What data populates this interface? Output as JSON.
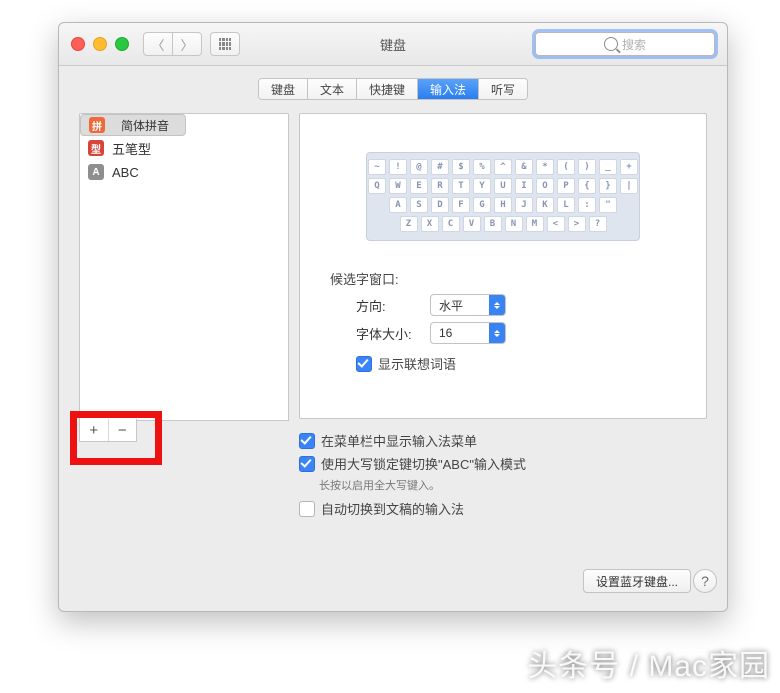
{
  "window": {
    "title": "键盘"
  },
  "search": {
    "placeholder": "搜索"
  },
  "tabs": [
    "键盘",
    "文本",
    "快捷键",
    "输入法",
    "听写"
  ],
  "active_tab_index": 3,
  "sources": [
    {
      "badge": "拼",
      "badge_color": "b-orange",
      "label": "简体拼音",
      "selected": true
    },
    {
      "badge": "型",
      "badge_color": "b-red",
      "label": "五笔型",
      "selected": false
    },
    {
      "badge": "A",
      "badge_color": "b-gray",
      "label": "ABC",
      "selected": false
    }
  ],
  "keyboard": {
    "r1": [
      "~",
      "!",
      "@",
      "#",
      "$",
      "%",
      "^",
      "&",
      "*",
      "(",
      ")",
      "_",
      "+"
    ],
    "r2": [
      "Q",
      "W",
      "E",
      "R",
      "T",
      "Y",
      "U",
      "I",
      "O",
      "P",
      "{",
      "}",
      "|"
    ],
    "r3": [
      "A",
      "S",
      "D",
      "F",
      "G",
      "H",
      "J",
      "K",
      "L",
      ":",
      "\""
    ],
    "r4": [
      "Z",
      "X",
      "C",
      "V",
      "B",
      "N",
      "M",
      "<",
      ">",
      "?"
    ]
  },
  "panel": {
    "candidate_title": "候选字窗口:",
    "direction_label": "方向:",
    "direction_value": "水平",
    "fontsize_label": "字体大小:",
    "fontsize_value": "16",
    "predictive_label": "显示联想词语"
  },
  "options": {
    "show_menu": "在菜单栏中显示输入法菜单",
    "caps_abc": "使用大写锁定键切换\"ABC\"输入模式",
    "caps_note": "长按以启用全大写键入。",
    "auto_switch": "自动切换到文稿的输入法"
  },
  "footer": {
    "bluetooth": "设置蓝牙键盘..."
  },
  "watermark": "头条号 / Mac家园"
}
